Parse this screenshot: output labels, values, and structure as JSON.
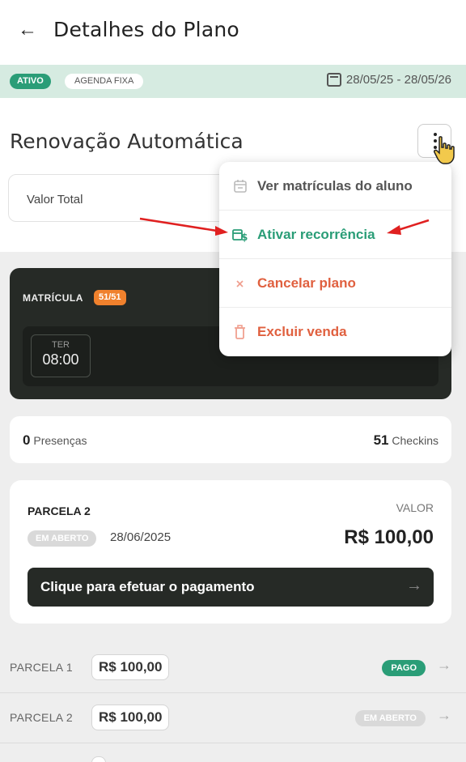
{
  "header": {
    "title": "Detalhes do Plano",
    "back_icon": "arrow-left-icon"
  },
  "status": {
    "active_label": "ATIVO",
    "agenda_label": "AGENDA FIXA",
    "date_range": "28/05/25 - 28/05/26"
  },
  "plan": {
    "renewal_title": "Renovação Automática",
    "valor_total_label": "Valor Total"
  },
  "menu": {
    "items": [
      {
        "label": "Ver matrículas do aluno",
        "icon": "calendar-icon",
        "color": "#555555"
      },
      {
        "label": "Ativar recorrência",
        "icon": "recurrence-money-icon",
        "color": "#2a9d77"
      },
      {
        "label": "Cancelar plano",
        "icon": "close-icon",
        "color": "#e0603f"
      },
      {
        "label": "Excluir venda",
        "icon": "trash-icon",
        "color": "#e0603f"
      }
    ]
  },
  "enrollment": {
    "label": "MATRÍCULA",
    "count": "51/51",
    "day": "TER",
    "time": "08:00"
  },
  "presence": {
    "presencas_count": "0",
    "presencas_label": "Presenças",
    "checkins_count": "51",
    "checkins_label": "Checkins"
  },
  "installment_card": {
    "title": "PARCELA 2",
    "valor_label": "VALOR",
    "status": "EM ABERTO",
    "date": "28/06/2025",
    "amount": "R$ 100,00",
    "pay_button": "Clique para efetuar o pagamento"
  },
  "installments": [
    {
      "label": "PARCELA 1",
      "amount": "R$ 100,00",
      "status": "PAGO",
      "status_color": "#2a9d77"
    },
    {
      "label": "PARCELA 2",
      "amount": "R$ 100,00",
      "status": "EM ABERTO",
      "status_color": "#d9d9d9"
    }
  ],
  "colors": {
    "accent": "#2a9d77",
    "danger": "#e0603f",
    "dark": "#262a26",
    "orange": "#f0812d",
    "annotation_arrow": "#e02020"
  }
}
